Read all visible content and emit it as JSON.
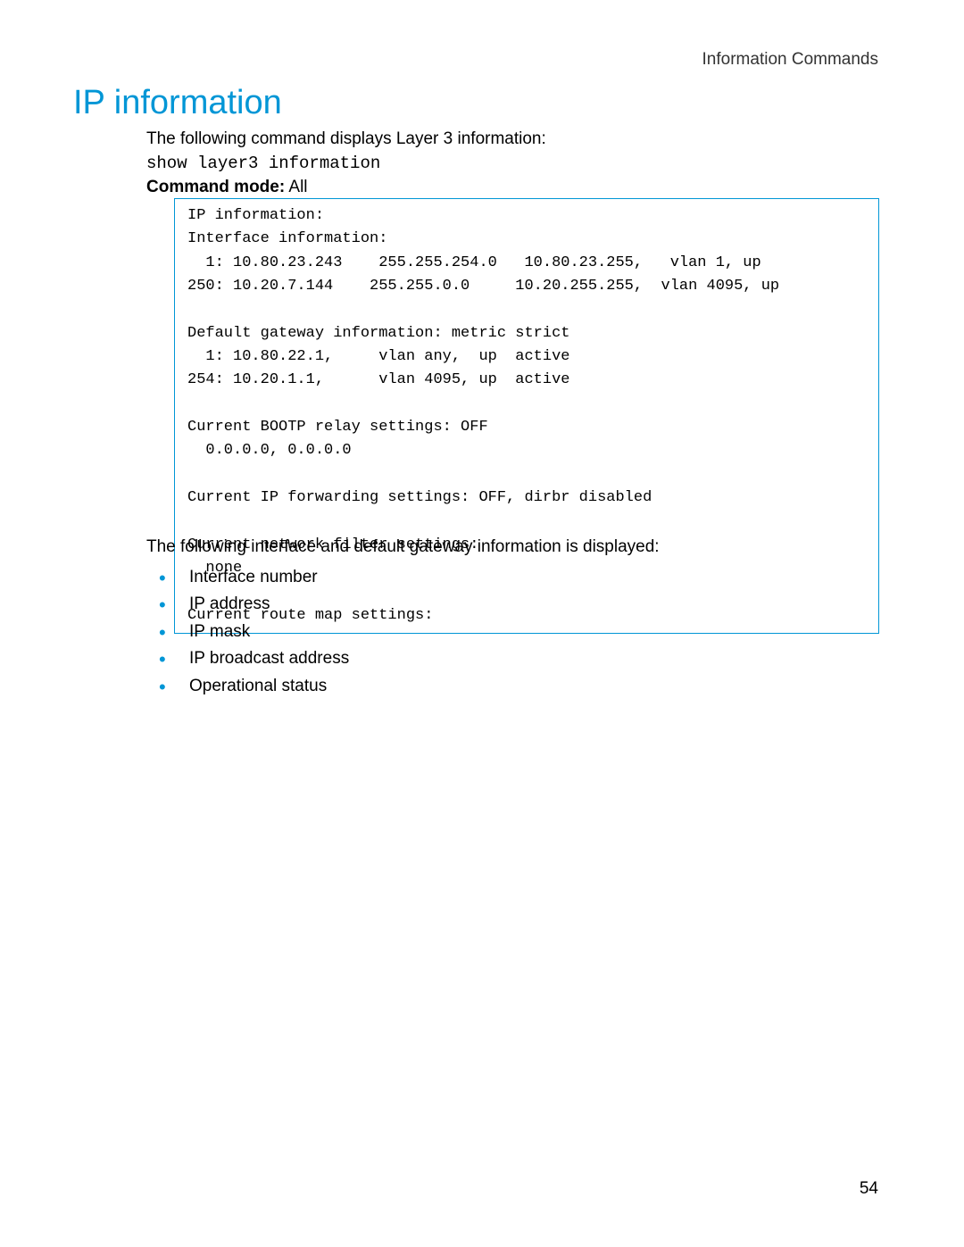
{
  "header": {
    "section_label": "Information Commands"
  },
  "heading": "IP information",
  "intro": "The following command displays Layer 3 information:",
  "command": "show layer3 information",
  "command_mode_label": "Command mode:",
  "command_mode_value": " All",
  "code_output": "IP information:\nInterface information:\n  1: 10.80.23.243    255.255.254.0   10.80.23.255,   vlan 1, up\n250: 10.20.7.144    255.255.0.0     10.20.255.255,  vlan 4095, up\n\nDefault gateway information: metric strict\n  1: 10.80.22.1,     vlan any,  up  active\n254: 10.20.1.1,      vlan 4095, up  active\n\nCurrent BOOTP relay settings: OFF\n  0.0.0.0, 0.0.0.0\n\nCurrent IP forwarding settings: OFF, dirbr disabled\n\nCurrent network filter settings:\n  none\n\nCurrent route map settings:",
  "followup": "The following interface and default gateway information is displayed:",
  "bullets": [
    "Interface number",
    "IP address",
    "IP mask",
    "IP broadcast address",
    "Operational status"
  ],
  "page_number": "54"
}
